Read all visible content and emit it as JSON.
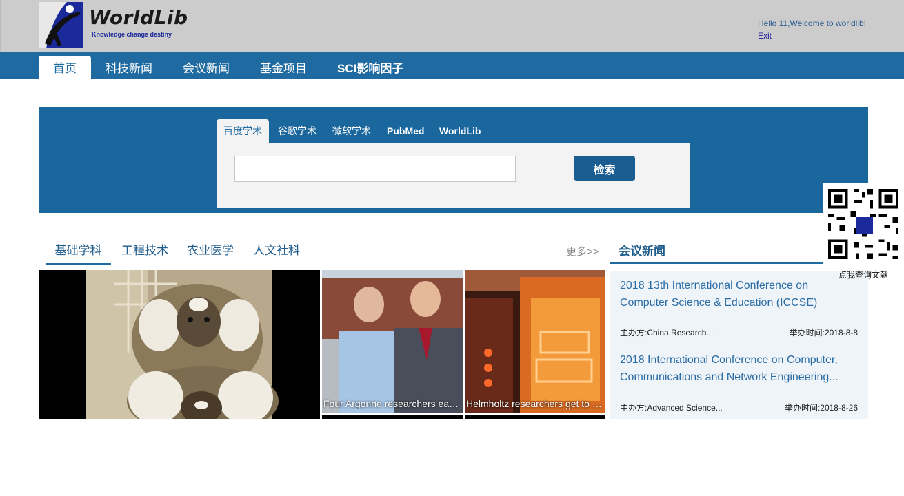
{
  "header": {
    "logo_title": "WorldLib",
    "logo_subtitle": "Knowledge change destiny",
    "greeting": "Hello 11,Welcome to worldlib!",
    "exit_label": "Exit"
  },
  "nav": {
    "items": [
      "首页",
      "科技新闻",
      "会议新闻",
      "基金项目",
      "SCI影响因子"
    ],
    "active_index": 0
  },
  "search": {
    "tabs": [
      "百度学术",
      "谷歌学术",
      "微软学术",
      "PubMed",
      "WorldLib"
    ],
    "active_index": 0,
    "input_value": "",
    "button_label": "检索"
  },
  "categories": {
    "tabs": [
      "基础学科",
      "工程技术",
      "农业医学",
      "人文社科"
    ],
    "active_index": 0,
    "more_label": "更多>>"
  },
  "news": {
    "thumbs": [
      {
        "caption": "Four Argonne researchers earn Fellow status"
      },
      {
        "caption": "Helmholtz researchers get to the bottom of"
      }
    ]
  },
  "conference": {
    "title": "会议新闻",
    "items": [
      {
        "title": "2018 13th International Conference on Computer Science & Education (ICCSE)",
        "organizer_label": "主办方:",
        "organizer": "China Research...",
        "date_label": "举办时间:",
        "date": "2018-8-8"
      },
      {
        "title": "2018 International Conference on Computer, Communications and Network Engineering...",
        "organizer_label": "主办方:",
        "organizer": "Advanced Science...",
        "date_label": "举办时间:",
        "date": "2018-8-26"
      }
    ]
  },
  "qr": {
    "caption": "点我查询文献"
  },
  "colors": {
    "nav_bg": "#1f6aa0",
    "header_bg": "#cccccc",
    "search_bg": "#1a679e",
    "button_bg": "#1a5e91"
  }
}
